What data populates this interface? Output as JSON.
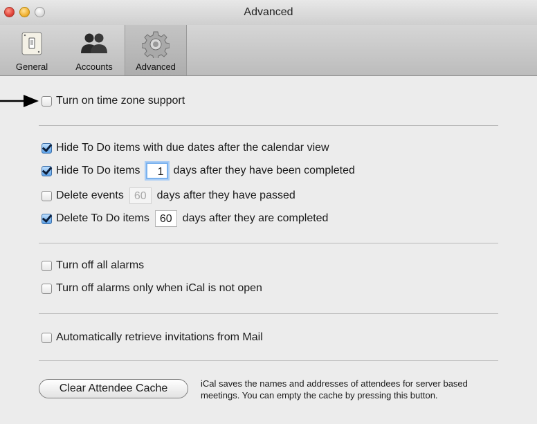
{
  "window": {
    "title": "Advanced"
  },
  "toolbar": {
    "tabs": [
      {
        "label": "General",
        "icon": "light-switch-icon"
      },
      {
        "label": "Accounts",
        "icon": "people-icon"
      },
      {
        "label": "Advanced",
        "icon": "gear-icon"
      }
    ],
    "selected": "Advanced"
  },
  "options": {
    "time_zone": {
      "label": "Turn on time zone support",
      "checked": false
    },
    "hide_todo_due": {
      "label": "Hide To Do items with due dates after the calendar view",
      "checked": true
    },
    "hide_todo_completed": {
      "label_before": "Hide To Do items",
      "value": "1",
      "label_after": "days after they have been completed",
      "checked": true
    },
    "delete_events": {
      "label_before": "Delete events",
      "value": "60",
      "label_after": "days after they have passed",
      "checked": false
    },
    "delete_todo": {
      "label_before": "Delete To Do items",
      "value": "60",
      "label_after": "days after they are completed",
      "checked": true
    },
    "alarms_off": {
      "label": "Turn off all alarms",
      "checked": false
    },
    "alarms_off_closed": {
      "label": "Turn off alarms only when iCal is not open",
      "checked": false
    },
    "invitations": {
      "label": "Automatically retrieve invitations from Mail",
      "checked": false
    }
  },
  "cache": {
    "button_label": "Clear Attendee Cache",
    "note": "iCal saves the names and addresses of attendees for server based meetings. You can empty the cache by pressing this button."
  },
  "colors": {
    "checkbox_checked": "#5aa0e6",
    "focus_ring": "#7bb2ee"
  }
}
